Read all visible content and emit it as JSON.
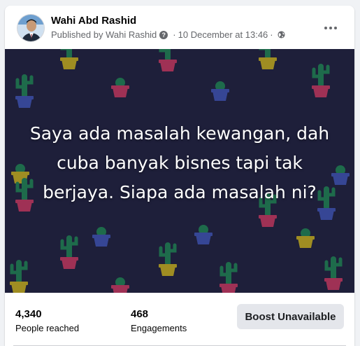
{
  "post": {
    "author": "Wahi Abd Rashid",
    "published_by_prefix": "Published by",
    "published_by_name": "Wahi Rashid",
    "question_icon": "help-icon",
    "date": "10 December at 13:46",
    "separator": "·",
    "privacy_icon": "globe-icon",
    "more_icon": "more-options-icon",
    "image_text": "Saya ada masalah kewangan, dah cuba banyak bisnes tapi tak berjaya. Siapa ada masalah ni?",
    "background_color": "#1e1f3a"
  },
  "stats": {
    "reached_value": "4,340",
    "reached_label": "People reached",
    "engagements_value": "468",
    "engagements_label": "Engagements",
    "boost_label": "Boost Unavailable"
  }
}
